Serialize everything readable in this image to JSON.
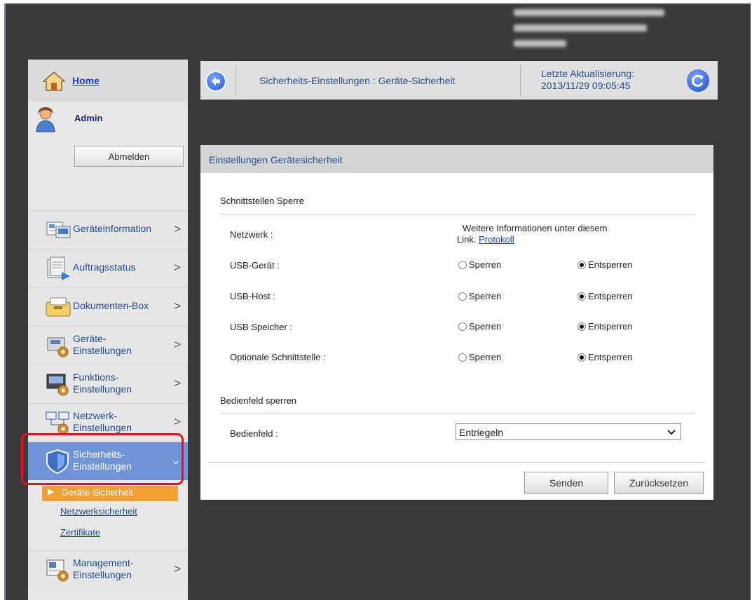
{
  "sidebar": {
    "home_label": "Home",
    "user_name": "Admin",
    "logout_label": "Abmelden",
    "items": [
      {
        "label1": "Geräteinformation",
        "label2": ""
      },
      {
        "label1": "Auftragsstatus",
        "label2": ""
      },
      {
        "label1": "Dokumenten-Box",
        "label2": ""
      },
      {
        "label1": "Geräte-",
        "label2": "Einstellungen"
      },
      {
        "label1": "Funktions-",
        "label2": "Einstellungen"
      },
      {
        "label1": "Netzwerk-",
        "label2": "Einstellungen"
      },
      {
        "label1": "Sicherheits-",
        "label2": "Einstellungen"
      },
      {
        "label1": "Management-",
        "label2": "Einstellungen"
      }
    ],
    "chevron": ">",
    "active_chevron": "⌄",
    "sub_items": {
      "active": "Geräte-Sicherheit",
      "bullet": "▶",
      "links": [
        "Netzwerksicherheit",
        "Zertifikate"
      ]
    }
  },
  "header": {
    "title": "Sicherheits-Einstellungen : Geräte-Sicherheit",
    "update_label": "Letzte Aktualisierung:",
    "update_time": "2013/11/29 09:05:45"
  },
  "panel": {
    "title": "Einstellungen Gerätesicherheit",
    "section1_title": "Schnittstellen Sperre",
    "network_label": "Netzwerk :",
    "network_info": "Weitere Informationen unter diesem",
    "network_info2": "Link.",
    "network_link": "Protokoll",
    "options": {
      "lock": "Sperren",
      "unlock": "Entsperren"
    },
    "rows": [
      {
        "label": "USB-Gerät :",
        "selected": "unlock"
      },
      {
        "label": "USB-Host :",
        "selected": "unlock"
      },
      {
        "label": "USB Speicher :",
        "selected": "unlock"
      },
      {
        "label": "Optionale Schnittstelle :",
        "selected": "unlock"
      }
    ],
    "section2_title": "Bedienfeld sperren",
    "panel_label": "Bedienfeld :",
    "panel_select_value": "Entriegeln",
    "submit_label": "Senden",
    "reset_label": "Zurücksetzen"
  },
  "colors": {
    "link": "#1f4d91",
    "active_nav": "#6f95d8",
    "sub_active": "#f1a133",
    "highlight": "#e4141b"
  }
}
